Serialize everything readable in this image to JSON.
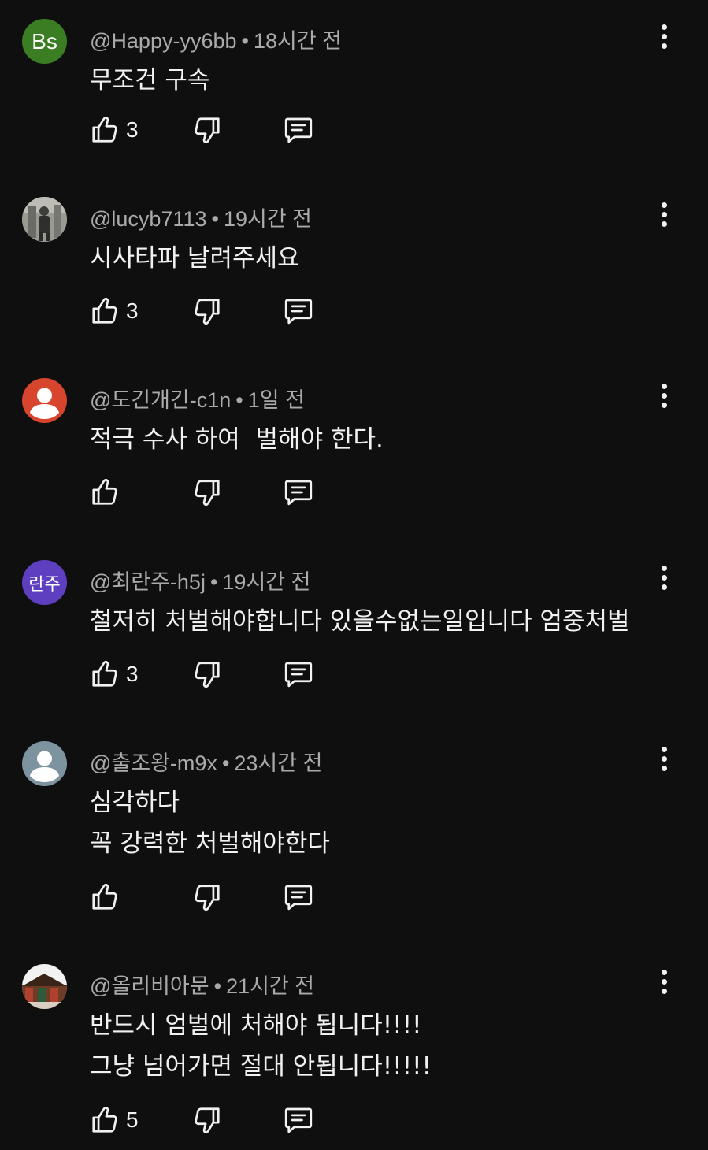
{
  "comments": [
    {
      "author": "@Happy-yy6bb",
      "time": "18시간 전",
      "avatar": {
        "type": "initials",
        "text": "Bs",
        "color": "#3a7d22"
      },
      "lines": [
        "무조건 구속"
      ],
      "likes": "3"
    },
    {
      "author": "@lucyb7113",
      "time": "19시간 전",
      "avatar": {
        "type": "photo",
        "color": "#8a8a84"
      },
      "lines": [
        "시사타파 날려주세요"
      ],
      "likes": "3"
    },
    {
      "author": "@도긴개긴-c1n",
      "time": "1일 전",
      "avatar": {
        "type": "default-person",
        "color": "#d8452f"
      },
      "lines": [
        "적극 수사 하여  벌해야 한다."
      ],
      "likes": ""
    },
    {
      "author": "@최란주-h5j",
      "time": "19시간 전",
      "avatar": {
        "type": "initials",
        "text": "란주",
        "color": "#5e3fbf"
      },
      "lines": [
        "철저히 처벌해야합니다 있을수없는일입니다 엄중처벌"
      ],
      "likes": "3"
    },
    {
      "author": "@출조왕-m9x",
      "time": "23시간 전",
      "avatar": {
        "type": "default-person",
        "color": "#7e93a0"
      },
      "lines": [
        "심각하다",
        "꼭 강력한 처벌해야한다"
      ],
      "likes": ""
    },
    {
      "author": "@올리비아문",
      "time": "21시간 전",
      "avatar": {
        "type": "photo",
        "color": "#5a3a2a"
      },
      "lines": [
        "반드시 엄벌에 처해야 됩니다!!!!",
        "그냥 넘어가면 절대 안됩니다!!!!!"
      ],
      "likes": "5"
    }
  ]
}
